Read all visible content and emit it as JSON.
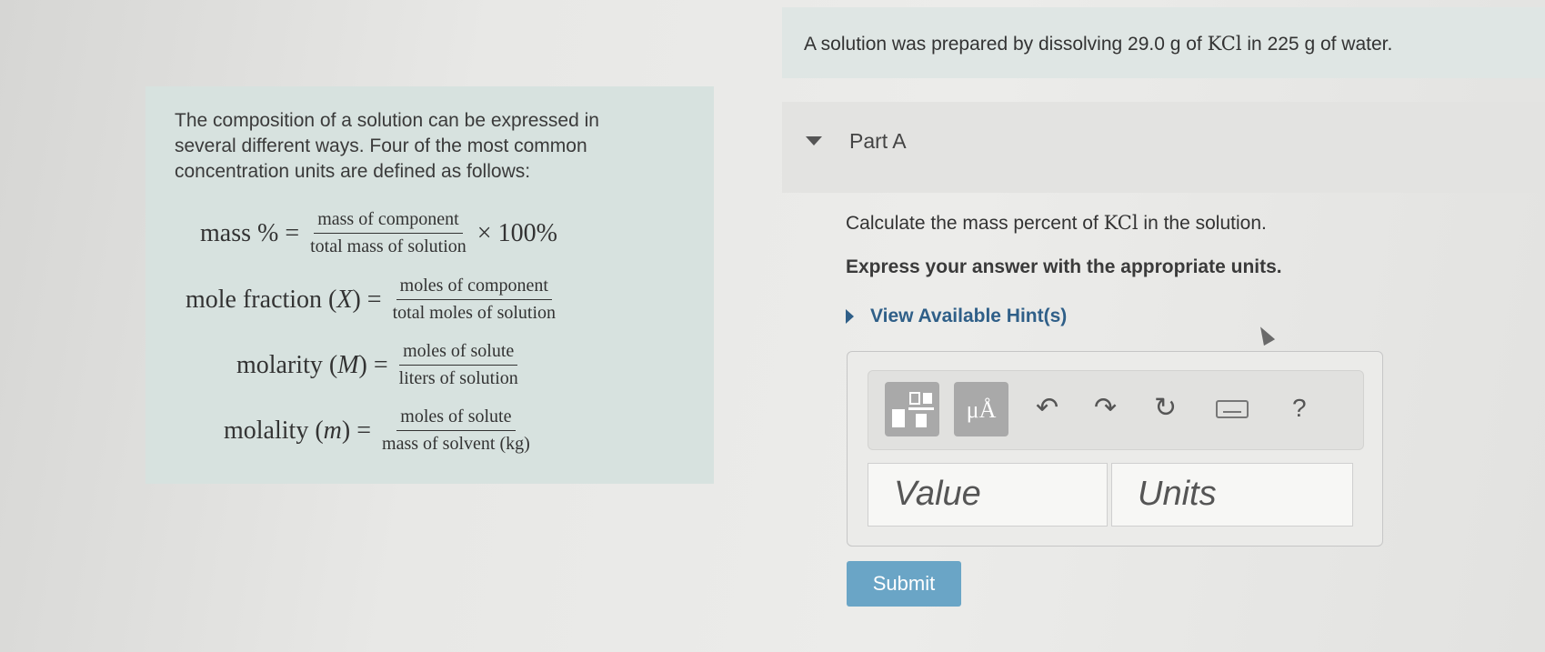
{
  "statement": {
    "prefix": "A solution was prepared by dissolving 29.0 g of",
    "compound": "KCl",
    "suffix": "in 225 g of water."
  },
  "info": {
    "intro": "The composition of a solution can be expressed in several different ways. Four of the most common concentration units are defined as follows:",
    "mass_percent": {
      "lhs": "mass % =",
      "num": "mass of component",
      "den": "total mass of solution",
      "rhs": "× 100%"
    },
    "mole_fraction": {
      "lhs_a": "mole fraction (",
      "var": "X",
      "lhs_b": ") =",
      "num": "moles of component",
      "den": "total moles of solution"
    },
    "molarity": {
      "lhs_a": "molarity (",
      "var": "M",
      "lhs_b": ") =",
      "num": "moles of solute",
      "den": "liters of solution"
    },
    "molality": {
      "lhs_a": "molality (",
      "var": "m",
      "lhs_b": ") =",
      "num": "moles of solute",
      "den": "mass of solvent (kg)"
    }
  },
  "part": {
    "title": "Part A"
  },
  "question": {
    "prefix": "Calculate the mass percent of",
    "compound": "KCl",
    "suffix": "in the solution."
  },
  "instruction": "Express your answer with the appropriate units.",
  "hints_label": "View Available Hint(s)",
  "toolbar": {
    "units_label": "μÅ",
    "undo": "↶",
    "redo": "↷",
    "reset": "↻",
    "help": "?"
  },
  "fields": {
    "value_placeholder": "Value",
    "units_placeholder": "Units"
  },
  "submit_label": "Submit"
}
